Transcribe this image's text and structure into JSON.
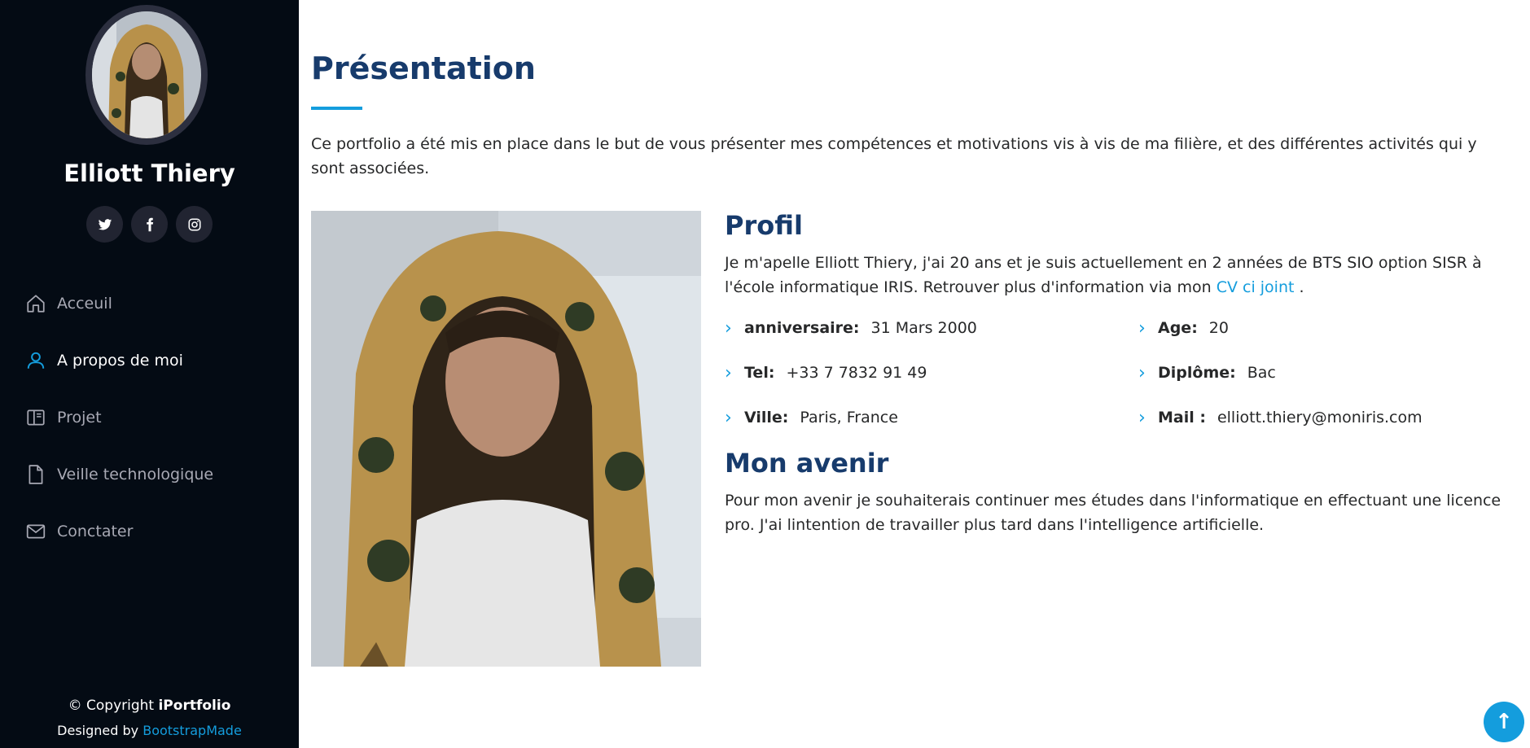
{
  "sidebar": {
    "name": "Elliott Thiery",
    "social": [
      {
        "icon": "twitter-icon",
        "glyph": "𝕥"
      },
      {
        "icon": "facebook-icon",
        "glyph": "f"
      },
      {
        "icon": "instagram-icon",
        "glyph": "◎"
      }
    ],
    "nav": [
      {
        "label": "Acceuil",
        "icon": "home-icon"
      },
      {
        "label": "A propos de moi",
        "icon": "person-icon",
        "active": true
      },
      {
        "label": "Projet",
        "icon": "book-icon"
      },
      {
        "label": "Veille technologique",
        "icon": "file-icon"
      },
      {
        "label": "Conctater",
        "icon": "envelope-icon"
      }
    ],
    "copyright_prefix": "© Copyright ",
    "copyright_brand": "iPortfolio",
    "credits_prefix": "Designed by ",
    "credits_link": "BootstrapMade"
  },
  "main": {
    "title": "Présentation",
    "intro": "Ce portfolio a été mis en place dans le but de vous présenter mes compétences et motivations vis à vis de ma filière, et des différentes activités qui y sont associées.",
    "profil": {
      "title": "Profil",
      "text_before": "Je m'apelle Elliott Thiery, j'ai 20 ans et je suis actuellement en 2 années de BTS SIO option SISR à l'école informatique IRIS. Retrouver plus d'information via mon ",
      "link": "CV ci joint",
      "text_after": " ."
    },
    "info": [
      {
        "label": "anniversaire:",
        "value": "31 Mars 2000"
      },
      {
        "label": "Age:",
        "value": "20"
      },
      {
        "label": "Tel:",
        "value": "+33 7 7832 91 49"
      },
      {
        "label": "Diplôme:",
        "value": "Bac"
      },
      {
        "label": "Ville:",
        "value": "Paris, France"
      },
      {
        "label": "Mail :",
        "value": "elliott.thiery@moniris.com"
      }
    ],
    "avenir": {
      "title": "Mon avenir",
      "text": "Pour mon avenir je souhaiterais continuer mes études dans l'informatique en effectuant une licence pro. J'ai lintention de travailler plus tard dans l'intelligence artificielle."
    }
  },
  "colors": {
    "sidebar_bg": "#040b14",
    "accent": "#149ddd",
    "heading": "#173b6c"
  },
  "back_to_top_glyph": "↑"
}
